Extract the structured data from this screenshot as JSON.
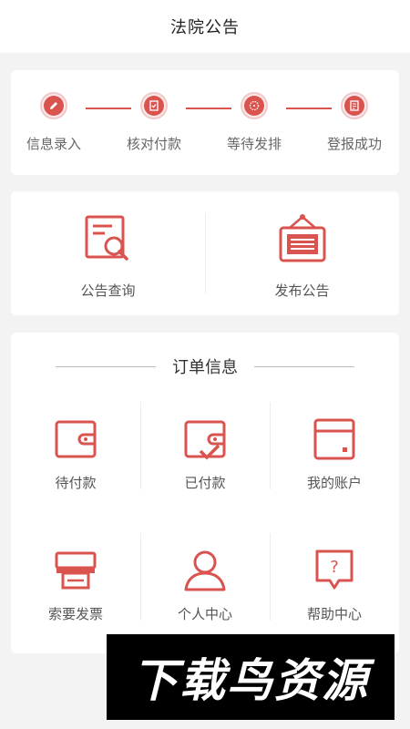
{
  "header": {
    "title": "法院公告"
  },
  "steps": [
    {
      "label": "信息录入",
      "icon": "pencil-icon"
    },
    {
      "label": "核对付款",
      "icon": "check-document-icon"
    },
    {
      "label": "等待发排",
      "icon": "clock-icon"
    },
    {
      "label": "登报成功",
      "icon": "success-document-icon"
    }
  ],
  "actions": [
    {
      "label": "公告查询",
      "icon": "search-document-icon"
    },
    {
      "label": "发布公告",
      "icon": "notice-board-icon"
    }
  ],
  "orders": {
    "title": "订单信息",
    "items": [
      {
        "label": "待付款",
        "icon": "wallet-icon"
      },
      {
        "label": "已付款",
        "icon": "wallet-check-icon"
      },
      {
        "label": "我的账户",
        "icon": "account-card-icon"
      },
      {
        "label": "索要发票",
        "icon": "printer-icon"
      },
      {
        "label": "个人中心",
        "icon": "user-icon"
      },
      {
        "label": "帮助中心",
        "icon": "help-icon"
      }
    ]
  },
  "watermark": {
    "text": "下载鸟资源"
  },
  "colors": {
    "accent": "#d9534f",
    "accent_light": "#fbeaea",
    "background": "#f3f3f3",
    "card": "#ffffff"
  }
}
